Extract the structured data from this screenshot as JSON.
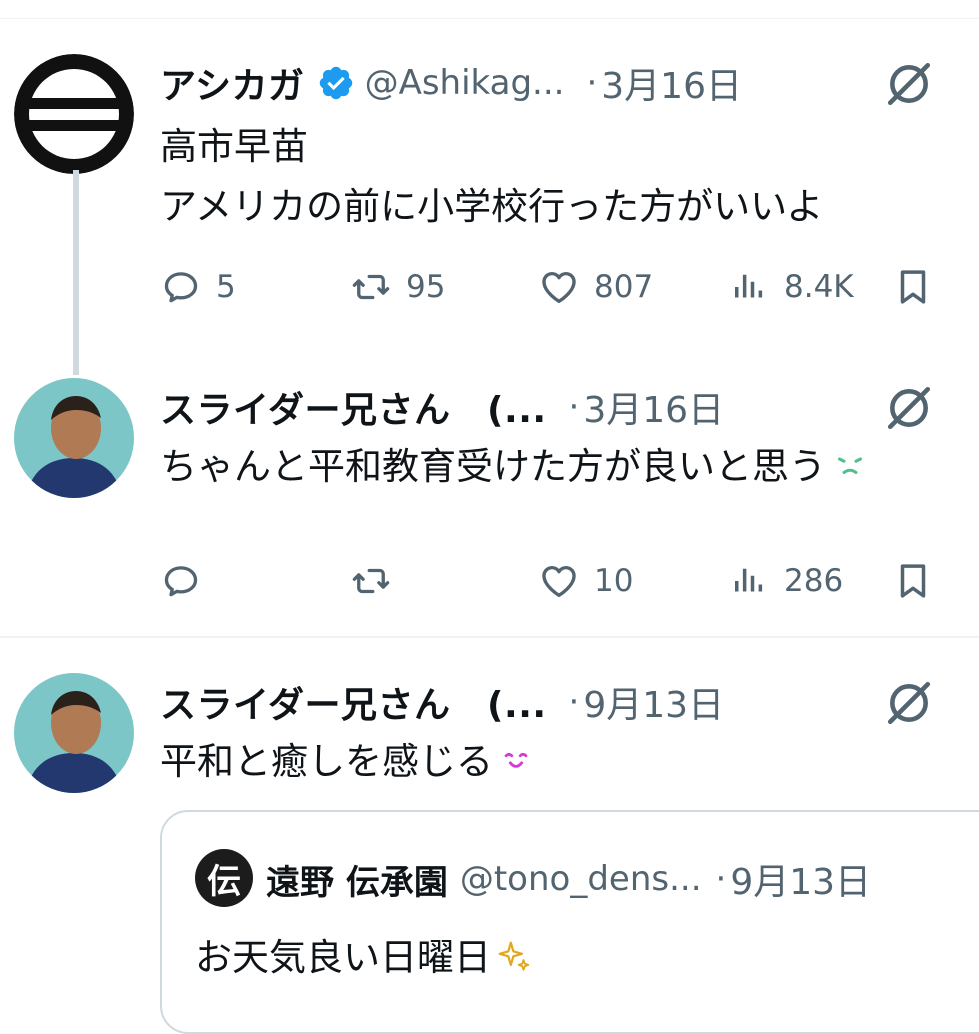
{
  "tweets": [
    {
      "name": "アシカガ",
      "handle": "@Ashikag...",
      "date": "3月16日",
      "lines": [
        "高市早苗",
        "アメリカの前に小学校行った方がいいよ"
      ],
      "replies": "5",
      "reposts": "95",
      "likes": "807",
      "views": "8.4K"
    },
    {
      "name": "スライダー兄さん　(...",
      "date": "3月16日",
      "lines": [
        "ちゃんと平和教育受けた方が良いと思う"
      ],
      "replies": "",
      "reposts": "",
      "likes": "10",
      "views": "286"
    },
    {
      "name": "スライダー兄さん　(...",
      "date": "9月13日",
      "lines": [
        "平和と癒しを感じる"
      ]
    }
  ],
  "quote": {
    "name": "遠野 伝承園",
    "handle": "@tono_dens...",
    "date": "9月13日",
    "text": "お天気良い日曜日",
    "avatar_glyph": "伝"
  },
  "separator": "·",
  "icons": [
    "verified-badge-icon",
    "grok-icon",
    "reply-icon",
    "repost-icon",
    "like-icon",
    "views-icon",
    "bookmark-icon",
    "crying-emoji-icon",
    "smiling-emoji-icon",
    "sparkles-emoji-icon"
  ],
  "colors": {
    "text": "#0f1419",
    "secondary": "#536471",
    "verified": "#1d9bf0",
    "divider": "#eff3f4",
    "thread_line": "#cfd9de"
  }
}
